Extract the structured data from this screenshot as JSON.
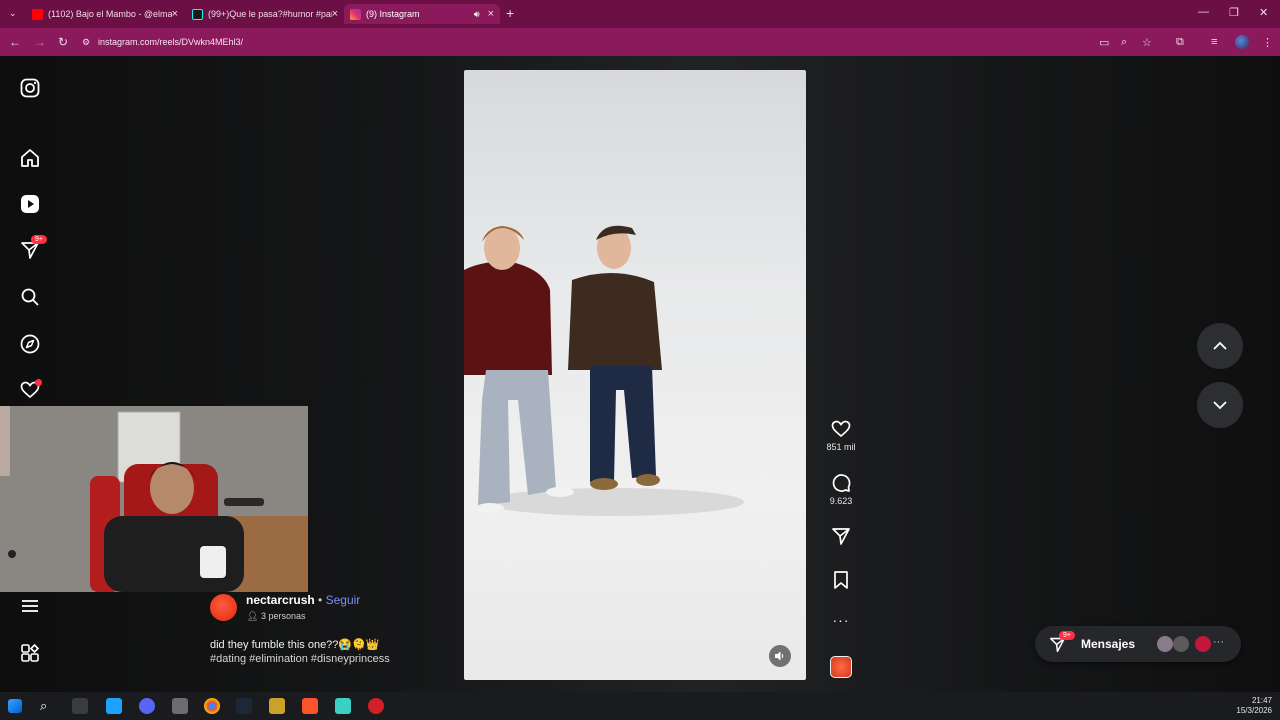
{
  "browser": {
    "tabs": [
      {
        "title": "(1102) Bajo el Mambo - @elma",
        "icon": "youtube-icon",
        "color": "#ff0000"
      },
      {
        "title": "(99+)Que le pasa?#humor #par",
        "icon": "tiktok-icon",
        "color": "#111111"
      },
      {
        "title": "(9) Instagram",
        "icon": "instagram-icon",
        "color": "#e1306c",
        "active": true
      }
    ],
    "url": "instagram.com/reels/DVwkn4MEhl3/",
    "accent_color": "#8a1a5b"
  },
  "sidebar": {
    "items": [
      {
        "name": "instagram-logo-icon"
      },
      {
        "name": "home-icon"
      },
      {
        "name": "reels-icon"
      },
      {
        "name": "messages-icon",
        "badge": "9+"
      },
      {
        "name": "search-icon"
      },
      {
        "name": "explore-icon"
      },
      {
        "name": "notifications-icon"
      },
      {
        "name": "menu-icon"
      },
      {
        "name": "more-apps-icon"
      }
    ]
  },
  "reel": {
    "likes": "851 mil",
    "comments": "9.623",
    "username": "nectarcrush",
    "separator": "•",
    "follow_label": "Seguir",
    "people": "3 personas",
    "caption_line1": "did they fumble this one??😭🫠👑",
    "caption_line2": "#dating #elimination #disneyprincess"
  },
  "messages": {
    "label": "Mensajes",
    "badge": "9+"
  },
  "taskbar": {
    "time": "21:47",
    "date": "15/3/2026"
  }
}
